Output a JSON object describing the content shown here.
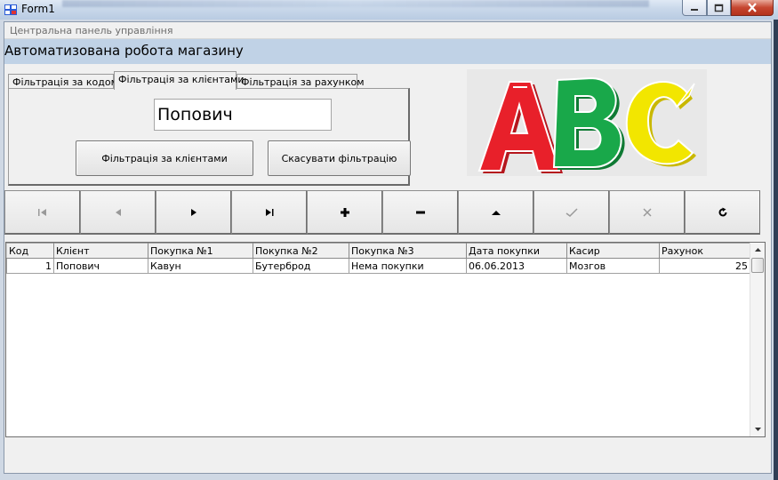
{
  "window": {
    "title": "Form1"
  },
  "menu": {
    "label": "Центральна панель управління"
  },
  "header": {
    "title": "Автоматизована робота магазину"
  },
  "tabs": [
    {
      "label": "Фільтрація за кодом",
      "active": false
    },
    {
      "label": "Фільтрація за клієнтами",
      "active": true
    },
    {
      "label": "Фільтрація за  рахунком",
      "active": false
    }
  ],
  "filter": {
    "client_value": "Попович",
    "filter_button": "Фільтрація за клієнтами",
    "cancel_button": "Скасувати фільтрацію"
  },
  "logo": {
    "letters": [
      "A",
      "B",
      "C"
    ],
    "colors": [
      "#e8202a",
      "#19a84a",
      "#f2e600"
    ]
  },
  "navigator": {
    "buttons": [
      {
        "name": "first",
        "icon": "first-record-icon",
        "enabled": false
      },
      {
        "name": "prior",
        "icon": "prior-record-icon",
        "enabled": false
      },
      {
        "name": "next",
        "icon": "next-record-icon",
        "enabled": true
      },
      {
        "name": "last",
        "icon": "last-record-icon",
        "enabled": true
      },
      {
        "name": "insert",
        "icon": "plus-icon",
        "enabled": true
      },
      {
        "name": "delete",
        "icon": "minus-icon",
        "enabled": true
      },
      {
        "name": "edit",
        "icon": "edit-triangle-icon",
        "enabled": true
      },
      {
        "name": "post",
        "icon": "checkmark-icon",
        "enabled": false
      },
      {
        "name": "cancel",
        "icon": "cancel-x-icon",
        "enabled": false
      },
      {
        "name": "refresh",
        "icon": "refresh-icon",
        "enabled": true
      }
    ]
  },
  "grid": {
    "columns": [
      "Код",
      "Клієнт",
      "Покупка №1",
      "Покупка №2",
      "Покупка №3",
      "Дата покупки",
      "Касир",
      "Рахунок"
    ],
    "rows": [
      [
        "1",
        "Попович",
        "Кавун",
        "Бутерброд",
        "Нема покупки",
        "06.06.2013",
        "Мозгов",
        "25"
      ]
    ]
  }
}
